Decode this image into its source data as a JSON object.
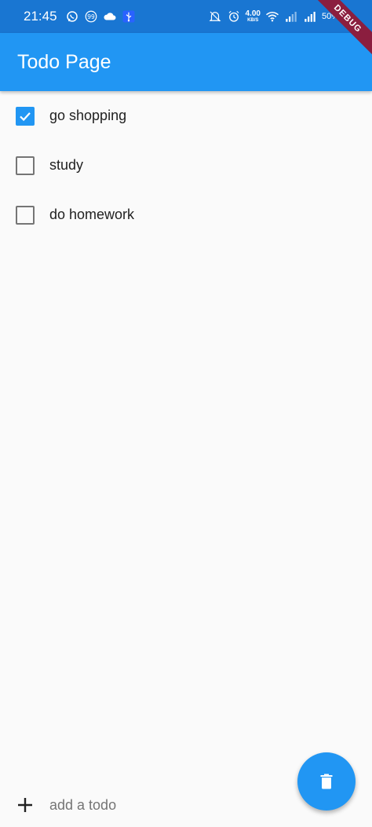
{
  "status_bar": {
    "time": "21:45",
    "net_speed_value": "4.00",
    "net_speed_unit": "KB/S",
    "battery": "50%",
    "left_icons": [
      "whatsapp-icon",
      "quote-icon",
      "cloud-icon",
      "usb-icon"
    ],
    "right_icons": [
      "mute-icon",
      "alarm-icon",
      "wifi-icon",
      "signal-icon",
      "signal-icon"
    ]
  },
  "debug_banner": "DEBUG",
  "app_bar": {
    "title": "Todo Page"
  },
  "todos": [
    {
      "label": "go shopping",
      "checked": true
    },
    {
      "label": "study",
      "checked": false
    },
    {
      "label": "do homework",
      "checked": false
    }
  ],
  "input": {
    "placeholder": "add a todo",
    "value": "",
    "add_icon": "plus-icon"
  },
  "fab": {
    "icon": "trash-icon"
  },
  "colors": {
    "status_bar": "#1976D2",
    "primary": "#2196F3",
    "background": "#fafafa",
    "debug_ribbon": "#8B1E3F"
  }
}
